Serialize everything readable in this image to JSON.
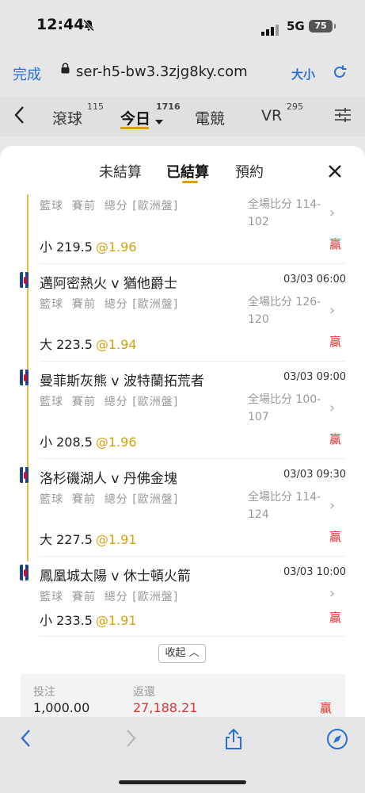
{
  "status_bar": {
    "time": "12:44",
    "network": "5G",
    "battery": "75"
  },
  "browser": {
    "done_label": "完成",
    "url": "ser-h5-bw3.3zjg8ky.com",
    "text_size_label": "大小"
  },
  "nav": {
    "tabs": [
      {
        "label": "滾球",
        "count": "115"
      },
      {
        "label": "今日",
        "count": "1716"
      },
      {
        "label": "電競",
        "count": ""
      },
      {
        "label": "VR",
        "count": "295"
      }
    ]
  },
  "sheet": {
    "tabs": [
      "未結算",
      "已結算",
      "預約"
    ],
    "items": [
      {
        "match": "",
        "datetime": "",
        "meta": "籃球  賽前  總分 [歐洲盤]",
        "score_label": "全場比分 114-102",
        "pick": "小 219.5",
        "odds": "@1.96",
        "result": "贏"
      },
      {
        "match": "邁阿密熱火 v 猶他爵士",
        "datetime": "03/03 06:00",
        "meta": "籃球  賽前  總分 [歐洲盤]",
        "score_label": "全場比分 126-120",
        "pick": "大 223.5",
        "odds": "@1.94",
        "result": "贏"
      },
      {
        "match": "曼菲斯灰熊 v 波特蘭拓荒者",
        "datetime": "03/03 09:00",
        "meta": "籃球  賽前  總分 [歐洲盤]",
        "score_label": "全場比分 100-107",
        "pick": "小 208.5",
        "odds": "@1.96",
        "result": "贏"
      },
      {
        "match": "洛杉磯湖人 v 丹佛金塊",
        "datetime": "03/03 09:30",
        "meta": "籃球  賽前  總分 [歐洲盤]",
        "score_label": "全場比分 114-124",
        "pick": "大 227.5",
        "odds": "@1.91",
        "result": "贏"
      },
      {
        "match": "鳳凰城太陽 v 休士頓火箭",
        "datetime": "03/03 10:00",
        "meta": "籃球  賽前  總分 [歐洲盤]",
        "score_label": "",
        "pick": "小 233.5",
        "odds": "@1.91",
        "result": "贏"
      }
    ],
    "collapse_label": "收起",
    "summary": {
      "stake_label": "投注",
      "stake": "1,000.00",
      "return_label": "返還",
      "return": "27,188.21",
      "result": "贏"
    }
  },
  "colors": {
    "accent": "#d4a20b",
    "link": "#2a6fd6",
    "win": "#d33333"
  }
}
